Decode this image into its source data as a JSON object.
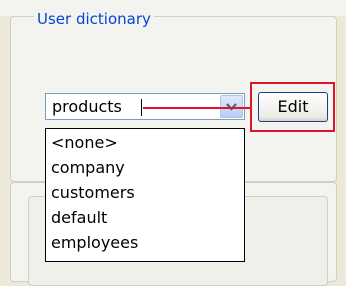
{
  "group": {
    "title": "User dictionary"
  },
  "combo": {
    "value": "products",
    "icon": "chevron-down-icon"
  },
  "edit_button": {
    "label": "Edit"
  },
  "dropdown": {
    "options": [
      "<none>",
      "company",
      "customers",
      "default",
      "employees"
    ]
  },
  "annotation": {
    "color": "#e0122c"
  }
}
